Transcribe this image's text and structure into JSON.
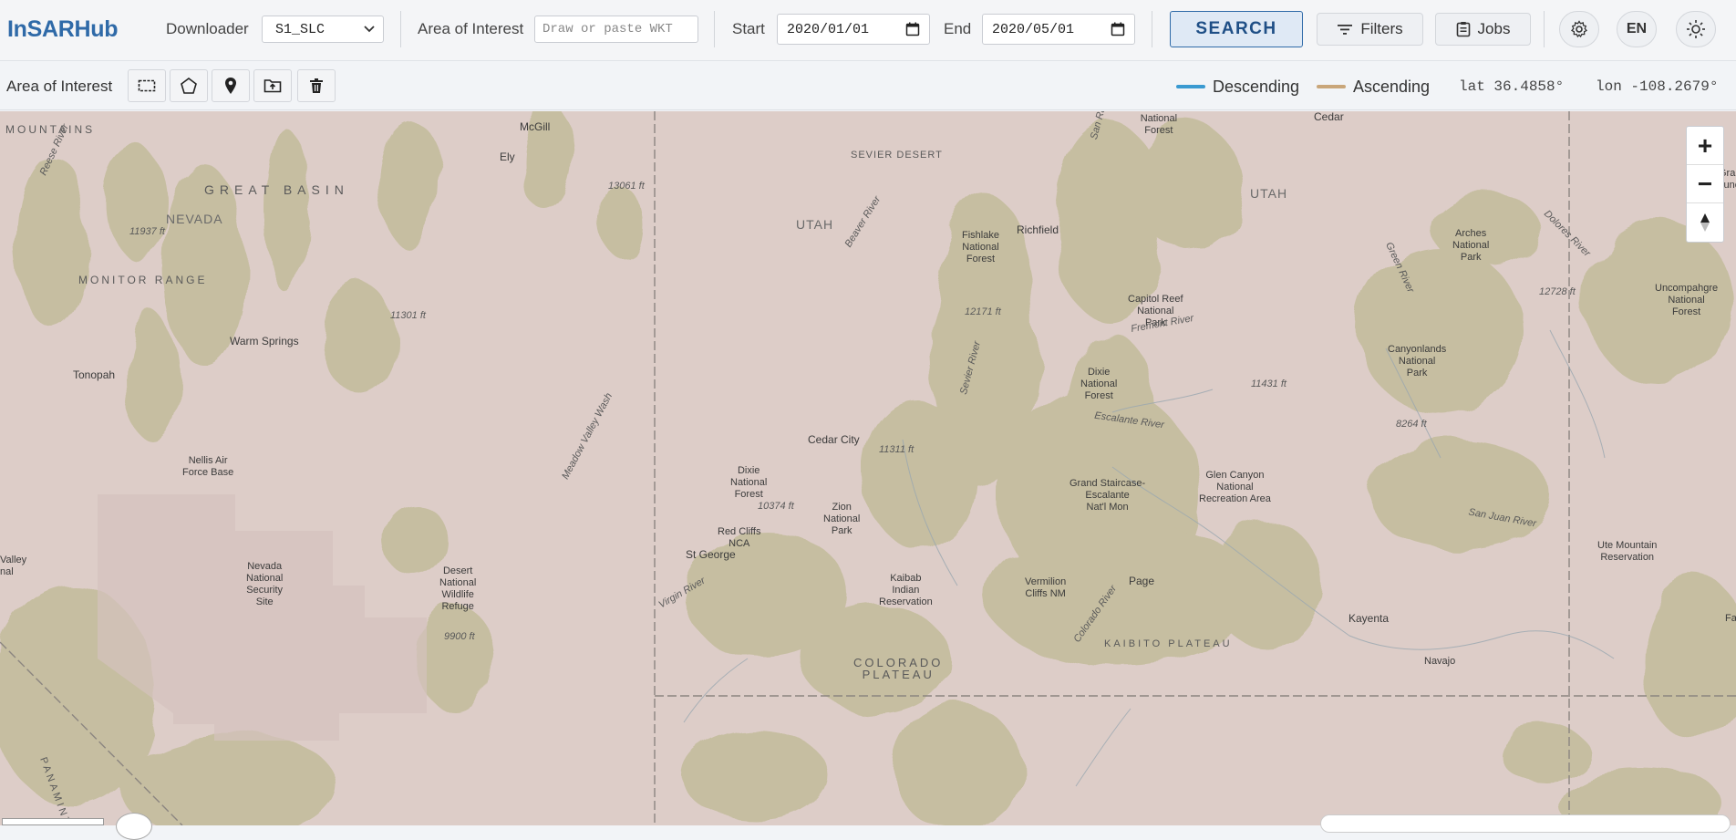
{
  "header": {
    "logo": "InSARHub",
    "downloader_label": "Downloader",
    "downloader_value": "S1_SLC",
    "aoi_label": "Area of Interest",
    "aoi_placeholder": "Draw or paste WKT",
    "start_label": "Start",
    "start_value": "2020/01/01",
    "end_label": "End",
    "end_value": "2020/05/01",
    "search_label": "SEARCH",
    "filters_label": "Filters",
    "jobs_label": "Jobs",
    "language": "EN"
  },
  "toolbar": {
    "aoi_label": "Area of Interest",
    "tools": [
      "rectangle-icon",
      "polygon-icon",
      "map-pin-icon",
      "folder-upload-icon",
      "trash-icon"
    ],
    "legend": [
      {
        "label": "Descending",
        "color": "#3a9ad1"
      },
      {
        "label": "Ascending",
        "color": "#c9a67a"
      }
    ],
    "lat": "lat 36.4858°",
    "lon": "lon -108.2679°"
  },
  "map": {
    "labels": {
      "mountains": "MOUNTAINS",
      "mcgill": "McGill",
      "ely": "Ely",
      "great_basin": "GREAT BASIN",
      "nevada": "NEVADA",
      "elev_11937": "11937 ft",
      "monitor_range": "MONITOR RANGE",
      "elev_11301": "11301 ft",
      "warm_springs": "Warm Springs",
      "tonopah": "Tonopah",
      "nellis": "Nellis Air\nForce Base",
      "nevada_nss": "Nevada\nNational\nSecurity\nSite",
      "desert_nwr": "Desert\nNational\nWildlife\nRefuge",
      "elev_9900": "9900 ft",
      "elev_13061": "13061 ft",
      "meadow_valley": "Meadow Valley Wash",
      "sevier_desert": "SEVIER DESERT",
      "utah_w": "UTAH",
      "beaver_river": "Beaver River",
      "fishlake": "Fishlake\nNational\nForest",
      "richfield": "Richfield",
      "elev_12171": "12171 ft",
      "manti": "Manti-La Sal\nNational\nForest",
      "cedar_ne": "Cedar",
      "utah_e": "UTAH",
      "capitol_reef": "Capitol Reef\nNational\nPark",
      "fremont": "Fremont River",
      "dixie_nf_n": "Dixie\nNational\nForest",
      "escalante": "Escalante River",
      "elev_11431": "11431 ft",
      "arches": "Arches\nNational\nPark",
      "elev_12728": "12728 ft",
      "uncompahgre": "Uncompahgre\nNational\nForest",
      "canyonlands": "Canyonlands\nNational\nPark",
      "elev_8264": "8264 ft",
      "cedar_city": "Cedar City",
      "elev_11311": "11311 ft",
      "dixie_nf_s": "Dixie\nNational\nForest",
      "elev_10374": "10374 ft",
      "zion": "Zion\nNational\nPark",
      "red_cliffs": "Red Cliffs\nNCA",
      "st_george": "St George",
      "gsenm": "Grand Staircase-\nEscalante\nNat'l Mon",
      "glen_canyon": "Glen Canyon\nNational\nRecreation Area",
      "san_juan": "San Juan River",
      "ute_mountain": "Ute Mountain\nReservation",
      "kaibab": "Kaibab\nIndian\nReservation",
      "vermilion": "Vermilion\nCliffs NM",
      "page": "Page",
      "kayenta": "Kayenta",
      "kaibito": "KAIBITO PLATEAU",
      "colorado_plateau": "COLORADO\nPLATEAU",
      "navajo": "Navajo",
      "panamint": "PANAMINT",
      "valley": "Valley\nnal",
      "grand_junc": "Gra\nJunc",
      "virgin_river": "Virgin River",
      "sevier_river": "Sevier River",
      "colorado_river": "Colorado River",
      "green_river": "Green River",
      "dolores_river": "Dolores River",
      "fa": "Fa",
      "snake_river": "Reese River",
      "san_rafael": "San Rafael"
    }
  }
}
